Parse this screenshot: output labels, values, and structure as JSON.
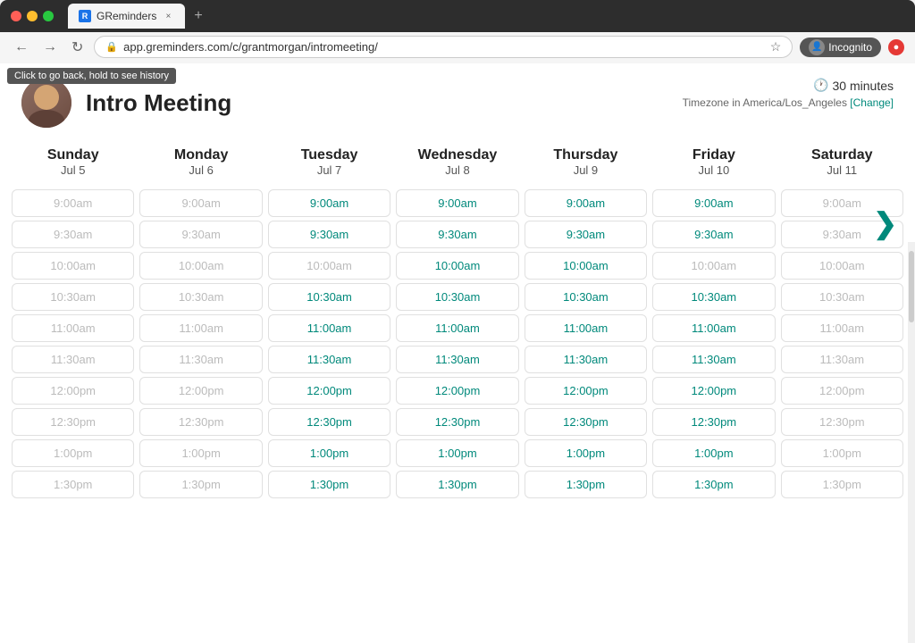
{
  "browser": {
    "tab_title": "GReminders",
    "tab_favicon": "R",
    "url": "app.greminders.com/c/grantmorgan/intromeeting/",
    "url_display": "app.greminders.com/c/grantmorgan/intromeeting/",
    "new_tab_label": "+",
    "back_tooltip": "Click to go back, hold to see history",
    "incognito_label": "Incognito"
  },
  "page": {
    "title": "Intro Meeting",
    "duration": "30 minutes",
    "timezone_label": "Timezone in America/Los_Angeles",
    "change_label": "[Change]",
    "nav_arrow": "❯"
  },
  "days": [
    {
      "name": "Sunday",
      "date": "Jul 5"
    },
    {
      "name": "Monday",
      "date": "Jul 6"
    },
    {
      "name": "Tuesday",
      "date": "Jul 7"
    },
    {
      "name": "Wednesday",
      "date": "Jul 8"
    },
    {
      "name": "Thursday",
      "date": "Jul 9"
    },
    {
      "name": "Friday",
      "date": "Jul 10"
    },
    {
      "name": "Saturday",
      "date": "Jul 11"
    }
  ],
  "time_slots": [
    "9:00am",
    "9:30am",
    "10:00am",
    "10:30am",
    "11:00am",
    "11:30am",
    "12:00pm",
    "12:30pm",
    "1:00pm",
    "1:30pm"
  ],
  "availability": {
    "0": [
      false,
      false,
      false,
      false,
      false,
      false,
      false,
      false,
      false,
      false
    ],
    "1": [
      false,
      false,
      false,
      false,
      false,
      false,
      false,
      false,
      false,
      false
    ],
    "2": [
      true,
      true,
      false,
      true,
      true,
      true,
      true,
      true,
      true,
      true
    ],
    "3": [
      true,
      true,
      true,
      true,
      true,
      true,
      true,
      true,
      true,
      true
    ],
    "4": [
      true,
      true,
      true,
      true,
      true,
      true,
      true,
      true,
      true,
      true
    ],
    "5": [
      true,
      true,
      false,
      true,
      true,
      true,
      true,
      true,
      true,
      true
    ],
    "6": [
      false,
      false,
      false,
      false,
      false,
      false,
      false,
      false,
      false,
      false
    ]
  }
}
